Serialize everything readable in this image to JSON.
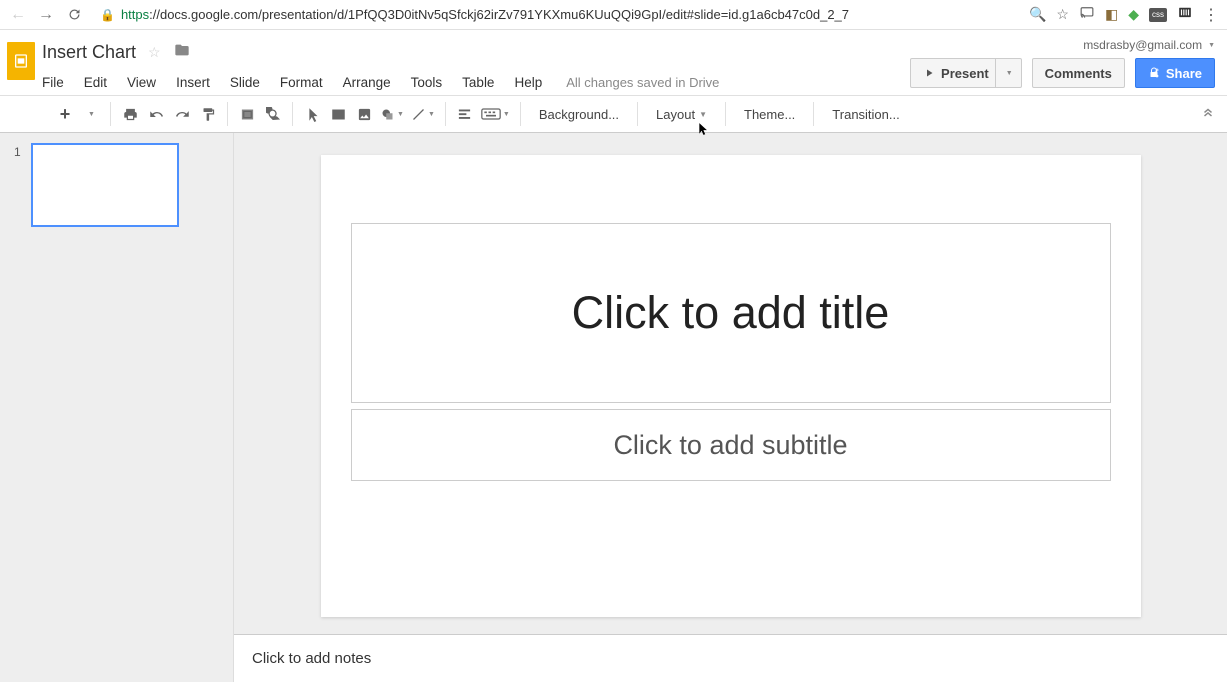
{
  "browser": {
    "url_prefix": "https",
    "url_rest": "://docs.google.com/presentation/d/1PfQQ3D0itNv5qSfckj62irZv791YKXmu6KUuQQi9GpI/edit#slide=id.g1a6cb47c0d_2_7",
    "ext_css": "css"
  },
  "header": {
    "doc_title": "Insert Chart",
    "user_email": "msdrasby@gmail.com",
    "save_status": "All changes saved in Drive"
  },
  "menus": [
    "File",
    "Edit",
    "View",
    "Insert",
    "Slide",
    "Format",
    "Arrange",
    "Tools",
    "Table",
    "Help"
  ],
  "buttons": {
    "present": "Present",
    "comments": "Comments",
    "share": "Share"
  },
  "toolbar": {
    "background": "Background...",
    "layout": "Layout",
    "theme": "Theme...",
    "transition": "Transition..."
  },
  "slides": {
    "num1": "1"
  },
  "canvas": {
    "title_placeholder": "Click to add title",
    "subtitle_placeholder": "Click to add subtitle",
    "notes_placeholder": "Click to add notes"
  }
}
